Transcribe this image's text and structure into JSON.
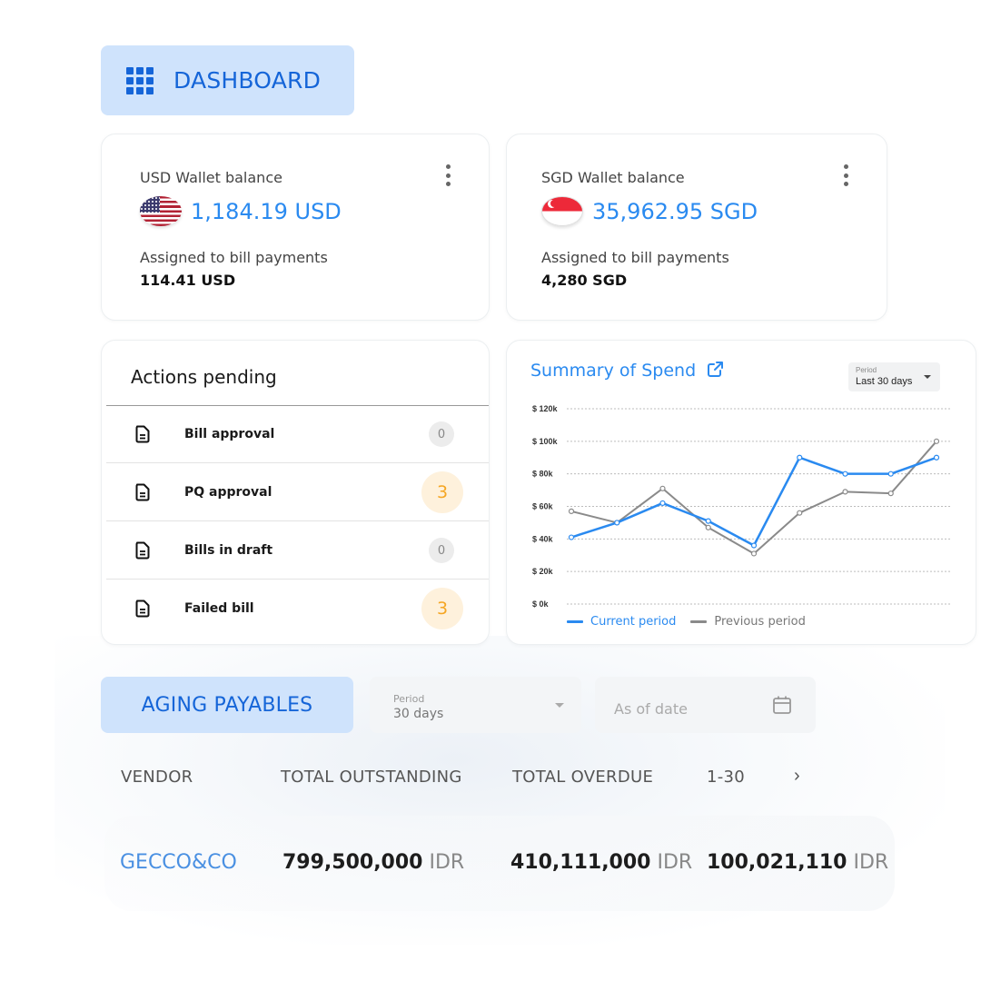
{
  "dashboard": {
    "label": "DASHBOARD",
    "icon": "grid-icon"
  },
  "wallets": [
    {
      "title": "USD Wallet balance",
      "flag": "us-flag-icon",
      "balance": "1,184.19 USD",
      "assigned_label": "Assigned to bill payments",
      "assigned_value": "114.41 USD",
      "menu_icon": "kebab-menu-icon"
    },
    {
      "title": "SGD Wallet balance",
      "flag": "sg-flag-icon",
      "balance": "35,962.95 SGD",
      "assigned_label": "Assigned to bill payments",
      "assigned_value": "4,280 SGD",
      "menu_icon": "kebab-menu-icon"
    }
  ],
  "actions": {
    "title": "Actions pending",
    "items": [
      {
        "label": "Bill approval",
        "count": "0",
        "icon": "document-icon"
      },
      {
        "label": "PQ approval",
        "count": "3",
        "icon": "document-icon"
      },
      {
        "label": "Bills in draft",
        "count": "0",
        "icon": "document-icon"
      },
      {
        "label": "Failed bill",
        "count": "3",
        "icon": "document-icon"
      }
    ]
  },
  "spend": {
    "title": "Summary of Spend",
    "link_icon": "external-link-icon",
    "period_label": "Period",
    "period_value": "Last 30 days"
  },
  "chart_data": {
    "type": "line",
    "title": "Summary of Spend",
    "xlabel": "",
    "ylabel": "",
    "x": [
      1,
      2,
      3,
      4,
      5,
      6,
      7,
      8,
      9
    ],
    "ylim": [
      0,
      120
    ],
    "yticks": [
      0,
      20,
      40,
      60,
      80,
      100,
      120
    ],
    "ytick_labels": [
      "$ 0k",
      "$ 20k",
      "$ 40k",
      "$ 60k",
      "$ 80k",
      "$ 100k",
      "$ 120k"
    ],
    "grid": true,
    "legend_position": "bottom-left",
    "series": [
      {
        "name": "Current period",
        "color": "#2a8af0",
        "values": [
          41,
          50,
          62,
          51,
          36,
          90,
          80,
          80,
          90
        ]
      },
      {
        "name": "Previous period",
        "color": "#8a8a8a",
        "values": [
          57,
          50,
          71,
          47,
          31,
          56,
          69,
          68,
          100
        ]
      }
    ]
  },
  "aging": {
    "label": "AGING PAYABLES",
    "period_label": "Period",
    "period_value": "30 days",
    "date_placeholder": "As of date",
    "columns": [
      "VENDOR",
      "TOTAL OUTSTANDING",
      "TOTAL OVERDUE",
      "1-30"
    ],
    "next_icon": "›",
    "rows": [
      {
        "vendor": "GECCO&CO",
        "total_outstanding": "799,500,000",
        "total_overdue": "410,111,000",
        "d1_30": "100,021,110",
        "currency": "IDR"
      }
    ]
  }
}
